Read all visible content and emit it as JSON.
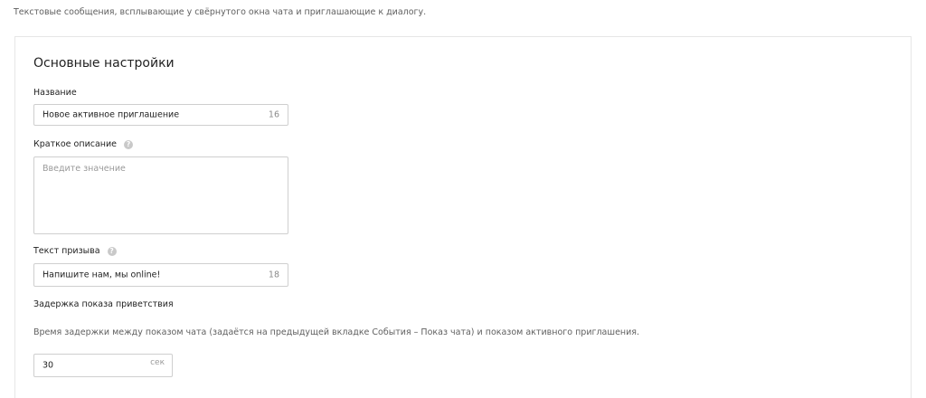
{
  "intro_text": "Текстовые сообщения, всплывающие у свёрнутого окна чата и приглашающие к диалогу.",
  "section": {
    "title": "Основные настройки"
  },
  "name_field": {
    "label": "Название",
    "value": "Новое активное приглашение",
    "counter": "16"
  },
  "description_field": {
    "label": "Краткое описание",
    "placeholder": "Введите значение",
    "help_icon": "question-circle-icon"
  },
  "cta_field": {
    "label": "Текст призыва",
    "value": "Напишите нам, мы online!",
    "counter": "18",
    "help_icon": "question-circle-icon"
  },
  "delay_field": {
    "label": "Задержка показа приветствия",
    "hint": "Время задержки между показом чата (задаётся на предыдущей вкладке События – Показ чата) и показом активного приглашения.",
    "value": "30",
    "unit": "сек"
  }
}
